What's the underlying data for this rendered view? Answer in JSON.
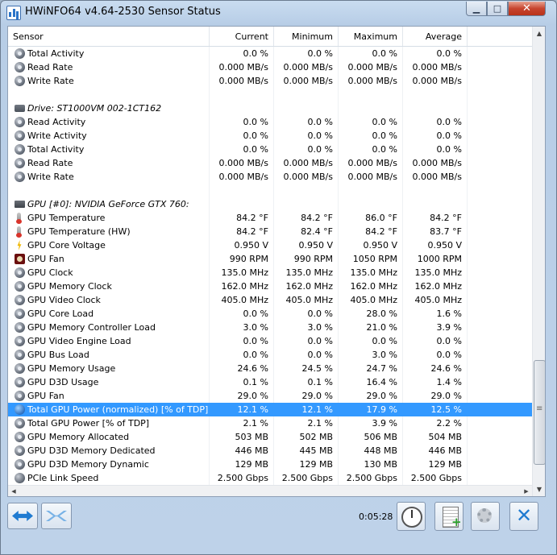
{
  "window": {
    "title": "HWiNFO64 v4.64-2530 Sensor Status",
    "controls": {
      "minimize": "▁",
      "maximize": "□",
      "close": "✕"
    }
  },
  "table": {
    "columns": [
      "Sensor",
      "Current",
      "Minimum",
      "Maximum",
      "Average"
    ],
    "rows": [
      {
        "kind": "sensor",
        "icon": "sensor",
        "label": "Total Activity",
        "values": [
          "0.0 %",
          "0.0 %",
          "0.0 %",
          "0.0 %"
        ]
      },
      {
        "kind": "sensor",
        "icon": "sensor",
        "label": "Read Rate",
        "values": [
          "0.000 MB/s",
          "0.000 MB/s",
          "0.000 MB/s",
          "0.000 MB/s"
        ]
      },
      {
        "kind": "sensor",
        "icon": "sensor",
        "label": "Write Rate",
        "values": [
          "0.000 MB/s",
          "0.000 MB/s",
          "0.000 MB/s",
          "0.000 MB/s"
        ]
      },
      {
        "kind": "blank",
        "label": "",
        "values": [
          "",
          "",
          "",
          ""
        ]
      },
      {
        "kind": "device",
        "icon": "drive",
        "label": "Drive: ST1000VM 002-1CT162",
        "values": [
          "",
          "",
          "",
          ""
        ]
      },
      {
        "kind": "sensor",
        "icon": "sensor",
        "label": "Read Activity",
        "values": [
          "0.0 %",
          "0.0 %",
          "0.0 %",
          "0.0 %"
        ]
      },
      {
        "kind": "sensor",
        "icon": "sensor",
        "label": "Write Activity",
        "values": [
          "0.0 %",
          "0.0 %",
          "0.0 %",
          "0.0 %"
        ]
      },
      {
        "kind": "sensor",
        "icon": "sensor",
        "label": "Total Activity",
        "values": [
          "0.0 %",
          "0.0 %",
          "0.0 %",
          "0.0 %"
        ]
      },
      {
        "kind": "sensor",
        "icon": "sensor",
        "label": "Read Rate",
        "values": [
          "0.000 MB/s",
          "0.000 MB/s",
          "0.000 MB/s",
          "0.000 MB/s"
        ]
      },
      {
        "kind": "sensor",
        "icon": "sensor",
        "label": "Write Rate",
        "values": [
          "0.000 MB/s",
          "0.000 MB/s",
          "0.000 MB/s",
          "0.000 MB/s"
        ]
      },
      {
        "kind": "blank",
        "label": "",
        "values": [
          "",
          "",
          "",
          ""
        ]
      },
      {
        "kind": "device",
        "icon": "gpu",
        "label": "GPU [#0]: NVIDIA GeForce GTX 760:",
        "values": [
          "",
          "",
          "",
          ""
        ]
      },
      {
        "kind": "sensor",
        "icon": "thermo",
        "label": "GPU Temperature",
        "values": [
          "84.2 °F",
          "84.2 °F",
          "86.0 °F",
          "84.2 °F"
        ]
      },
      {
        "kind": "sensor",
        "icon": "thermo",
        "label": "GPU Temperature (HW)",
        "values": [
          "84.2 °F",
          "82.4 °F",
          "84.2 °F",
          "83.7 °F"
        ]
      },
      {
        "kind": "sensor",
        "icon": "bolt",
        "label": "GPU Core Voltage",
        "values": [
          "0.950 V",
          "0.950 V",
          "0.950 V",
          "0.950 V"
        ]
      },
      {
        "kind": "sensor",
        "icon": "fan",
        "label": "GPU Fan",
        "values": [
          "990 RPM",
          "990 RPM",
          "1050 RPM",
          "1000 RPM"
        ]
      },
      {
        "kind": "sensor",
        "icon": "sensor",
        "label": "GPU Clock",
        "values": [
          "135.0 MHz",
          "135.0 MHz",
          "135.0 MHz",
          "135.0 MHz"
        ]
      },
      {
        "kind": "sensor",
        "icon": "sensor",
        "label": "GPU Memory Clock",
        "values": [
          "162.0 MHz",
          "162.0 MHz",
          "162.0 MHz",
          "162.0 MHz"
        ]
      },
      {
        "kind": "sensor",
        "icon": "sensor",
        "label": "GPU Video Clock",
        "values": [
          "405.0 MHz",
          "405.0 MHz",
          "405.0 MHz",
          "405.0 MHz"
        ]
      },
      {
        "kind": "sensor",
        "icon": "sensor",
        "label": "GPU Core Load",
        "values": [
          "0.0 %",
          "0.0 %",
          "28.0 %",
          "1.6 %"
        ]
      },
      {
        "kind": "sensor",
        "icon": "sensor",
        "label": "GPU Memory Controller Load",
        "values": [
          "3.0 %",
          "3.0 %",
          "21.0 %",
          "3.9 %"
        ]
      },
      {
        "kind": "sensor",
        "icon": "sensor",
        "label": "GPU Video Engine Load",
        "values": [
          "0.0 %",
          "0.0 %",
          "0.0 %",
          "0.0 %"
        ]
      },
      {
        "kind": "sensor",
        "icon": "sensor",
        "label": "GPU Bus Load",
        "values": [
          "0.0 %",
          "0.0 %",
          "3.0 %",
          "0.0 %"
        ]
      },
      {
        "kind": "sensor",
        "icon": "sensor",
        "label": "GPU Memory Usage",
        "values": [
          "24.6 %",
          "24.5 %",
          "24.7 %",
          "24.6 %"
        ]
      },
      {
        "kind": "sensor",
        "icon": "sensor",
        "label": "GPU D3D Usage",
        "values": [
          "0.1 %",
          "0.1 %",
          "16.4 %",
          "1.4 %"
        ]
      },
      {
        "kind": "sensor",
        "icon": "sensor",
        "label": "GPU Fan",
        "values": [
          "29.0 %",
          "29.0 %",
          "29.0 %",
          "29.0 %"
        ]
      },
      {
        "kind": "sensor",
        "icon": "globe",
        "selected": true,
        "label": "Total GPU Power (normalized) [% of TDP]",
        "values": [
          "12.1 %",
          "12.1 %",
          "17.9 %",
          "12.5 %"
        ]
      },
      {
        "kind": "sensor",
        "icon": "sensor",
        "label": "Total GPU Power [% of TDP]",
        "values": [
          "2.1 %",
          "2.1 %",
          "3.9 %",
          "2.2 %"
        ]
      },
      {
        "kind": "sensor",
        "icon": "sensor",
        "label": "GPU Memory Allocated",
        "values": [
          "503 MB",
          "502 MB",
          "506 MB",
          "504 MB"
        ]
      },
      {
        "kind": "sensor",
        "icon": "sensor",
        "label": "GPU D3D Memory Dedicated",
        "values": [
          "446 MB",
          "445 MB",
          "448 MB",
          "446 MB"
        ]
      },
      {
        "kind": "sensor",
        "icon": "sensor",
        "label": "GPU D3D Memory Dynamic",
        "values": [
          "129 MB",
          "129 MB",
          "130 MB",
          "129 MB"
        ]
      },
      {
        "kind": "sensor",
        "icon": "pcie",
        "label": "PCIe Link Speed",
        "values": [
          "2.500 Gbps",
          "2.500 Gbps",
          "2.500 Gbps",
          "2.500 Gbps"
        ]
      }
    ]
  },
  "toolbar": {
    "timer": "0:05:28"
  },
  "colors": {
    "selection": "#3399ff",
    "accent": "#1f7bd1"
  }
}
